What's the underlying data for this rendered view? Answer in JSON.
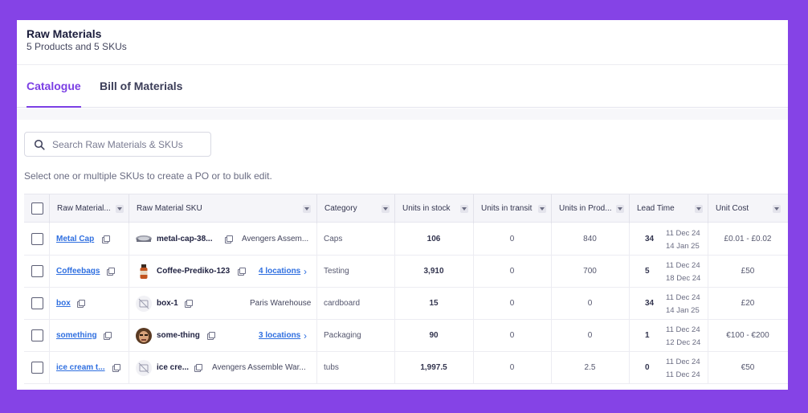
{
  "header": {
    "title": "Raw Materials",
    "subtitle": "5 Products and 5 SKUs"
  },
  "tabs": [
    {
      "label": "Catalogue",
      "active": true
    },
    {
      "label": "Bill of Materials",
      "active": false
    }
  ],
  "search": {
    "placeholder": "Search Raw Materials & SKUs",
    "value": ""
  },
  "hint": "Select one or multiple SKUs to create a PO or to bulk edit.",
  "columns": [
    "Raw Material...",
    "Raw Material SKU",
    "Category",
    "Units in stock",
    "Units in transit",
    "Units in Prod...",
    "Lead Time",
    "Unit Cost"
  ],
  "rows": [
    {
      "name": "Metal Cap",
      "sku": "metal-cap-38...",
      "location": "Avengers Assem...",
      "location_is_link": false,
      "thumb": "metal-cap",
      "category": "Caps",
      "stock": "106",
      "transit": "0",
      "prod": "840",
      "lead": "34",
      "date1": "11 Dec 24",
      "date2": "14 Jan 25",
      "cost": "£0.01 - £0.02"
    },
    {
      "name": "Coffeebags",
      "sku": "Coffee-Prediko-123",
      "location": "4 locations",
      "location_is_link": true,
      "thumb": "bottle",
      "category": "Testing",
      "stock": "3,910",
      "transit": "0",
      "prod": "700",
      "lead": "5",
      "date1": "11 Dec 24",
      "date2": "18 Dec 24",
      "cost": "£50"
    },
    {
      "name": "box",
      "sku": "box-1",
      "location": "Paris Warehouse",
      "location_is_link": false,
      "thumb": "no-image",
      "category": "cardboard",
      "stock": "15",
      "transit": "0",
      "prod": "0",
      "lead": "34",
      "date1": "11 Dec 24",
      "date2": "14 Jan 25",
      "cost": "£20"
    },
    {
      "name": "something",
      "sku": "some-thing",
      "location": "3 locations",
      "location_is_link": true,
      "thumb": "face",
      "category": "Packaging",
      "stock": "90",
      "transit": "0",
      "prod": "0",
      "lead": "1",
      "date1": "11 Dec 24",
      "date2": "12 Dec 24",
      "cost": "€100 - €200"
    },
    {
      "name": "ice cream t...",
      "sku": "ice cre...",
      "location": "Avengers Assemble War...",
      "location_is_link": false,
      "thumb": "no-image",
      "category": "tubs",
      "stock": "1,997.5",
      "transit": "0",
      "prod": "2.5",
      "lead": "0",
      "date1": "11 Dec 24",
      "date2": "11 Dec 24",
      "cost": "€50"
    }
  ],
  "colors": {
    "accent": "#7b3fe4",
    "link": "#2f6fe0",
    "frame": "#8543e6"
  }
}
